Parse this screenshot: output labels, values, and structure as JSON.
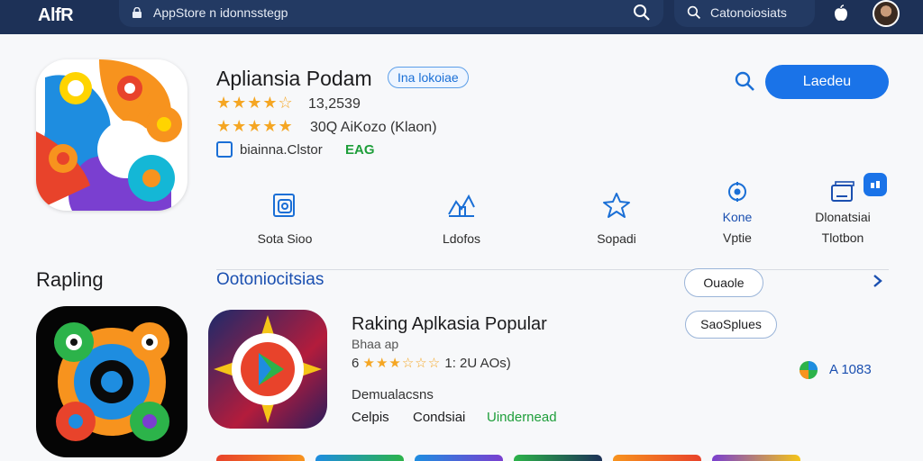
{
  "topbar": {
    "logo": "AlfR",
    "url": "AppStore n idonnsstegp",
    "search_text": "Catonoiosiats"
  },
  "app": {
    "title": "Apliansia Podam",
    "tag": "Ina lokoiae",
    "rating_count": "13,2539",
    "rating_text": "30Q AiKozo (Klaon)",
    "developer": "biainna.Clstor",
    "developer_badge": "EAG",
    "stars_1": "★★★★☆",
    "stars_2": "★★★★★",
    "primary_action": "Laedeu"
  },
  "features": [
    {
      "label": "Sota Sioo",
      "icon": "document-icon"
    },
    {
      "label": "Ldofos",
      "icon": "chart-icon"
    },
    {
      "label": "Sopadi",
      "icon": "star-icon"
    },
    {
      "label": "Kone",
      "sublabel": "Vptie",
      "icon": "settings-icon"
    },
    {
      "label": "Dlonatsiai",
      "sublabel": "Tlotbon",
      "icon": "gallery-icon"
    }
  ],
  "section": {
    "title": "Rapling",
    "subtitle": "Ootoniocitsias",
    "pill_1": "Ouaole",
    "pill_2": "SaoSplues"
  },
  "list_item": {
    "title": "Raking Aplkasia Popular",
    "sub": "Bhaa ap",
    "rating_prefix": "6",
    "stars": "★★★☆☆☆",
    "rating_suffix": "1: 2U AOs)",
    "downloads": "Demualacsns",
    "tags": [
      "Celpis",
      "Condsiai",
      "Uindernead"
    ],
    "side_count": "A 1083"
  },
  "colors": {
    "topbar": "#1d3157",
    "accent": "#1a73e8",
    "star": "#f5a623",
    "green": "#1e9e3a"
  }
}
